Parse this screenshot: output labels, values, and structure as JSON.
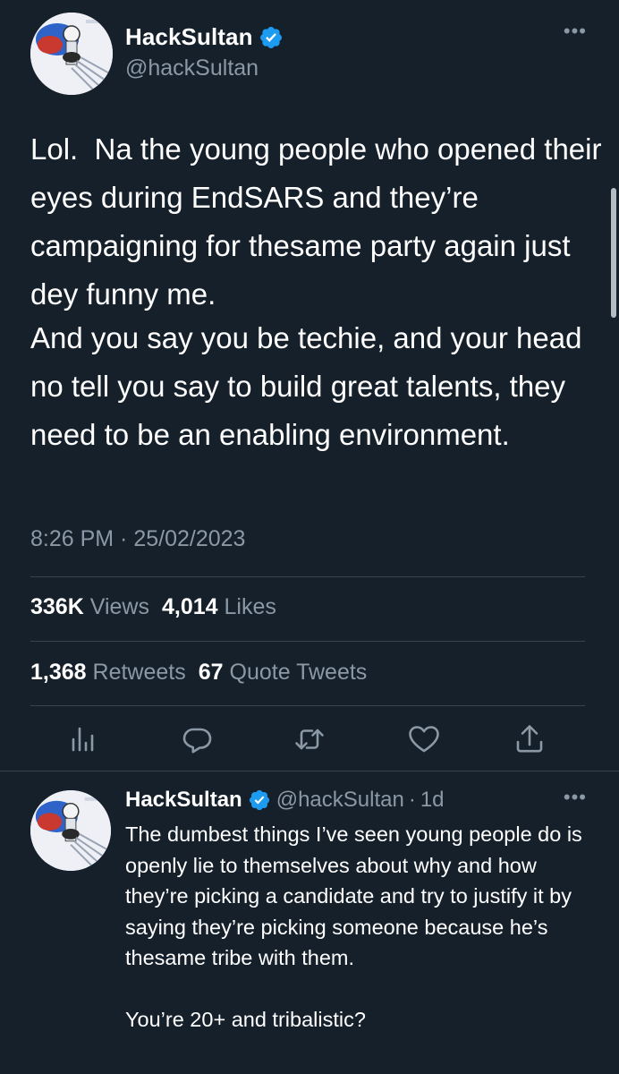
{
  "tweet": {
    "author": {
      "display_name": "HackSultan",
      "handle": "@hackSultan",
      "verified": true,
      "avatar": "avatar-image"
    },
    "more_icon": "more-horizontal-icon",
    "paragraphs": [
      "Lol.  Na the young people who opened their eyes during EndSARS and they’re campaigning for thesame party again just dey funny me.",
      "And you say you be techie, and your head no tell you say to build great talents, they need to be an enabling environment."
    ],
    "timestamp": "8:26 PM · 25/02/2023",
    "stats": {
      "views_count": "336K",
      "views_label": "Views",
      "likes_count": "4,014",
      "likes_label": "Likes",
      "retweets_count": "1,368",
      "retweets_label": "Retweets",
      "quotes_count": "67",
      "quotes_label": "Quote Tweets"
    },
    "actions": [
      {
        "icon": "analytics-icon"
      },
      {
        "icon": "reply-icon"
      },
      {
        "icon": "retweet-icon"
      },
      {
        "icon": "like-icon"
      },
      {
        "icon": "share-icon"
      }
    ]
  },
  "reply": {
    "author": {
      "display_name": "HackSultan",
      "handle": "@hackSultan",
      "verified": true
    },
    "separator": "·",
    "time": "1d",
    "text": "The dumbest things I’ve seen young people do is openly lie to themselves about why and how they’re picking a candidate and try to justify it by saying they’re picking someone because he’s thesame tribe with them.\n\nYou’re 20+ and tribalistic?"
  },
  "colors": {
    "background": "#15202b",
    "text": "#ffffff",
    "secondary_text": "#8b98a5",
    "divider": "#38444d",
    "verified_badge": "#1d9bf0"
  }
}
